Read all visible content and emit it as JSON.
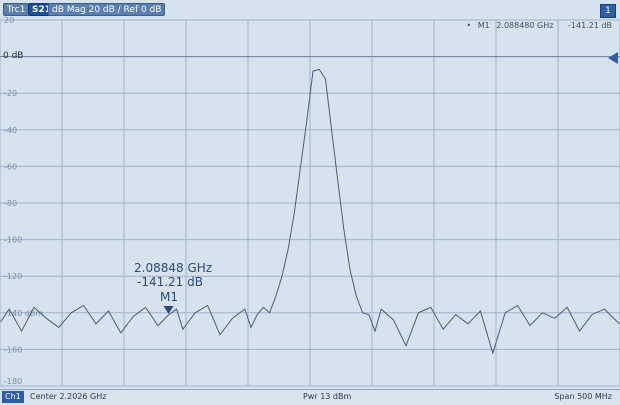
{
  "header": {
    "trace": "Trc1",
    "parameter": "S21",
    "format": "dB Mag  20 dB / Ref 0 dB",
    "window_number": "1"
  },
  "marker_readout": {
    "name": "M1",
    "frequency": "2.088480  GHz",
    "value": "-141.21  dB"
  },
  "reference": {
    "label": "0 dB"
  },
  "marker_annotation": {
    "frequency": "2.08848 GHz",
    "value": "-141.21 dB",
    "name": "M1"
  },
  "status_bar": {
    "channel": "Ch1",
    "center": "Center  2.2026 GHz",
    "power": "Pwr  13 dBm",
    "span": "Span  500 MHz"
  },
  "colors": {
    "background": "#d6e2ee",
    "grid": "#9fb4c9",
    "trace": "#4b5e78",
    "accent": "#2e5ea8"
  },
  "chart_data": {
    "type": "line",
    "title": "",
    "xlabel": "",
    "ylabel": "",
    "xlim": [
      1.9526,
      2.4526
    ],
    "ylim": [
      -180,
      20
    ],
    "x_unit": "GHz",
    "y_unit": "dB",
    "ytick_labels": [
      "20",
      "0 dB",
      "-20",
      "-40",
      "-60",
      "-80",
      "-100",
      "-120",
      "-140 dBm",
      "-160",
      "-180"
    ],
    "ytick_values": [
      20,
      0,
      -20,
      -40,
      -60,
      -80,
      -100,
      -120,
      -140,
      -160,
      -180
    ],
    "grid": true,
    "reference_level": 0,
    "noise_floor": -142,
    "series": [
      {
        "x": [
          1.953,
          1.96,
          1.97,
          1.98,
          1.99,
          2.0,
          2.01,
          2.02,
          2.03,
          2.04,
          2.05,
          2.06,
          2.07,
          2.08,
          2.0885,
          2.095,
          2.1,
          2.11,
          2.12,
          2.13,
          2.14,
          2.15,
          2.155,
          2.16,
          2.165,
          2.17,
          2.175,
          2.18,
          2.185,
          2.19,
          2.195,
          2.2,
          2.205,
          2.21,
          2.215,
          2.22,
          2.225,
          2.23,
          2.235,
          2.24,
          2.245,
          2.25,
          2.255,
          2.26,
          2.27,
          2.28,
          2.29,
          2.3,
          2.31,
          2.32,
          2.33,
          2.34,
          2.35,
          2.36,
          2.37,
          2.38,
          2.39,
          2.4,
          2.41,
          2.42,
          2.43,
          2.44,
          2.452
        ],
        "y": [
          -145,
          -138,
          -150,
          -137,
          -143,
          -148,
          -140,
          -136,
          -146,
          -139,
          -151,
          -142,
          -137,
          -147,
          -141.21,
          -138,
          -149,
          -140,
          -136,
          -152,
          -143,
          -138,
          -148,
          -141,
          -137,
          -140,
          -131,
          -120,
          -105,
          -85,
          -60,
          -35,
          -8,
          -7,
          -12,
          -40,
          -68,
          -95,
          -117,
          -131,
          -140,
          -141,
          -150,
          -138,
          -144,
          -158,
          -140,
          -137,
          -149,
          -141,
          -146,
          -139,
          -162,
          -140,
          -136,
          -147,
          -140,
          -143,
          -137,
          -150,
          -141,
          -138,
          -146
        ]
      }
    ],
    "markers": [
      {
        "name": "M1",
        "x": 2.08848,
        "y": -141.21
      }
    ]
  }
}
